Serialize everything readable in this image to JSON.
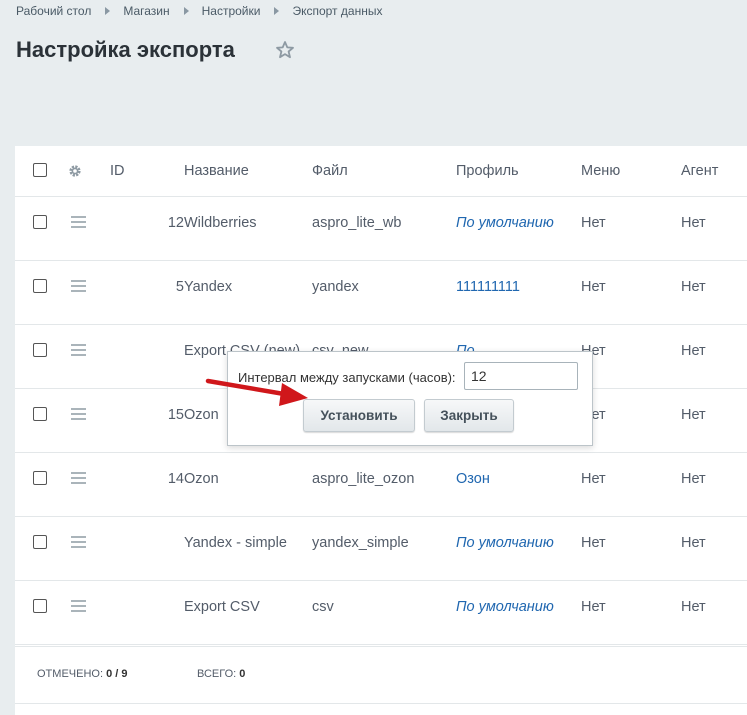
{
  "breadcrumb": [
    "Рабочий стол",
    "Магазин",
    "Настройки",
    "Экспорт данных"
  ],
  "page_title": "Настройка экспорта",
  "table": {
    "columns": [
      "ID",
      "Название",
      "Файл",
      "Профиль",
      "Меню",
      "Агент"
    ],
    "rows": [
      {
        "id": "12",
        "name": "Wildberries",
        "file": "aspro_lite_wb",
        "profile": "По умолчанию",
        "menu": "Нет",
        "agent": "Нет"
      },
      {
        "id": "5",
        "name": "Yandex",
        "file": "yandex",
        "profile": "111111111",
        "menu": "Нет",
        "agent": "Нет"
      },
      {
        "id": "",
        "name": "Export CSV (new)",
        "file": "csv_new",
        "profile": "По",
        "menu": "Нет",
        "agent": "Нет"
      },
      {
        "id": "15",
        "name": "Ozon",
        "file": "",
        "profile": "",
        "menu": "Нет",
        "agent": "Нет"
      },
      {
        "id": "14",
        "name": "Ozon",
        "file": "aspro_lite_ozon",
        "profile": "Озон",
        "menu": "Нет",
        "agent": "Нет"
      },
      {
        "id": "",
        "name": "Yandex - simple",
        "file": "yandex_simple",
        "profile": "По умолчанию",
        "menu": "Нет",
        "agent": "Нет"
      },
      {
        "id": "",
        "name": "Export CSV",
        "file": "csv",
        "profile": "По умолчанию",
        "menu": "Нет",
        "agent": "Нет"
      }
    ]
  },
  "footer": {
    "selected_label": "ОТМЕЧЕНО:",
    "selected_value": "0 / 9",
    "total_label": "ВСЕГО:",
    "total_value": "0"
  },
  "popup": {
    "interval_label": "Интервал между запусками (часов):",
    "interval_value": "12",
    "set_button": "Установить",
    "close_button": "Закрыть"
  },
  "colors": {
    "link": "#2067b0",
    "arrow": "#d0171b",
    "background": "#e8edef"
  },
  "icons": [
    "star-icon",
    "gear-icon",
    "drag-handle-icon",
    "arrow-annotation"
  ]
}
